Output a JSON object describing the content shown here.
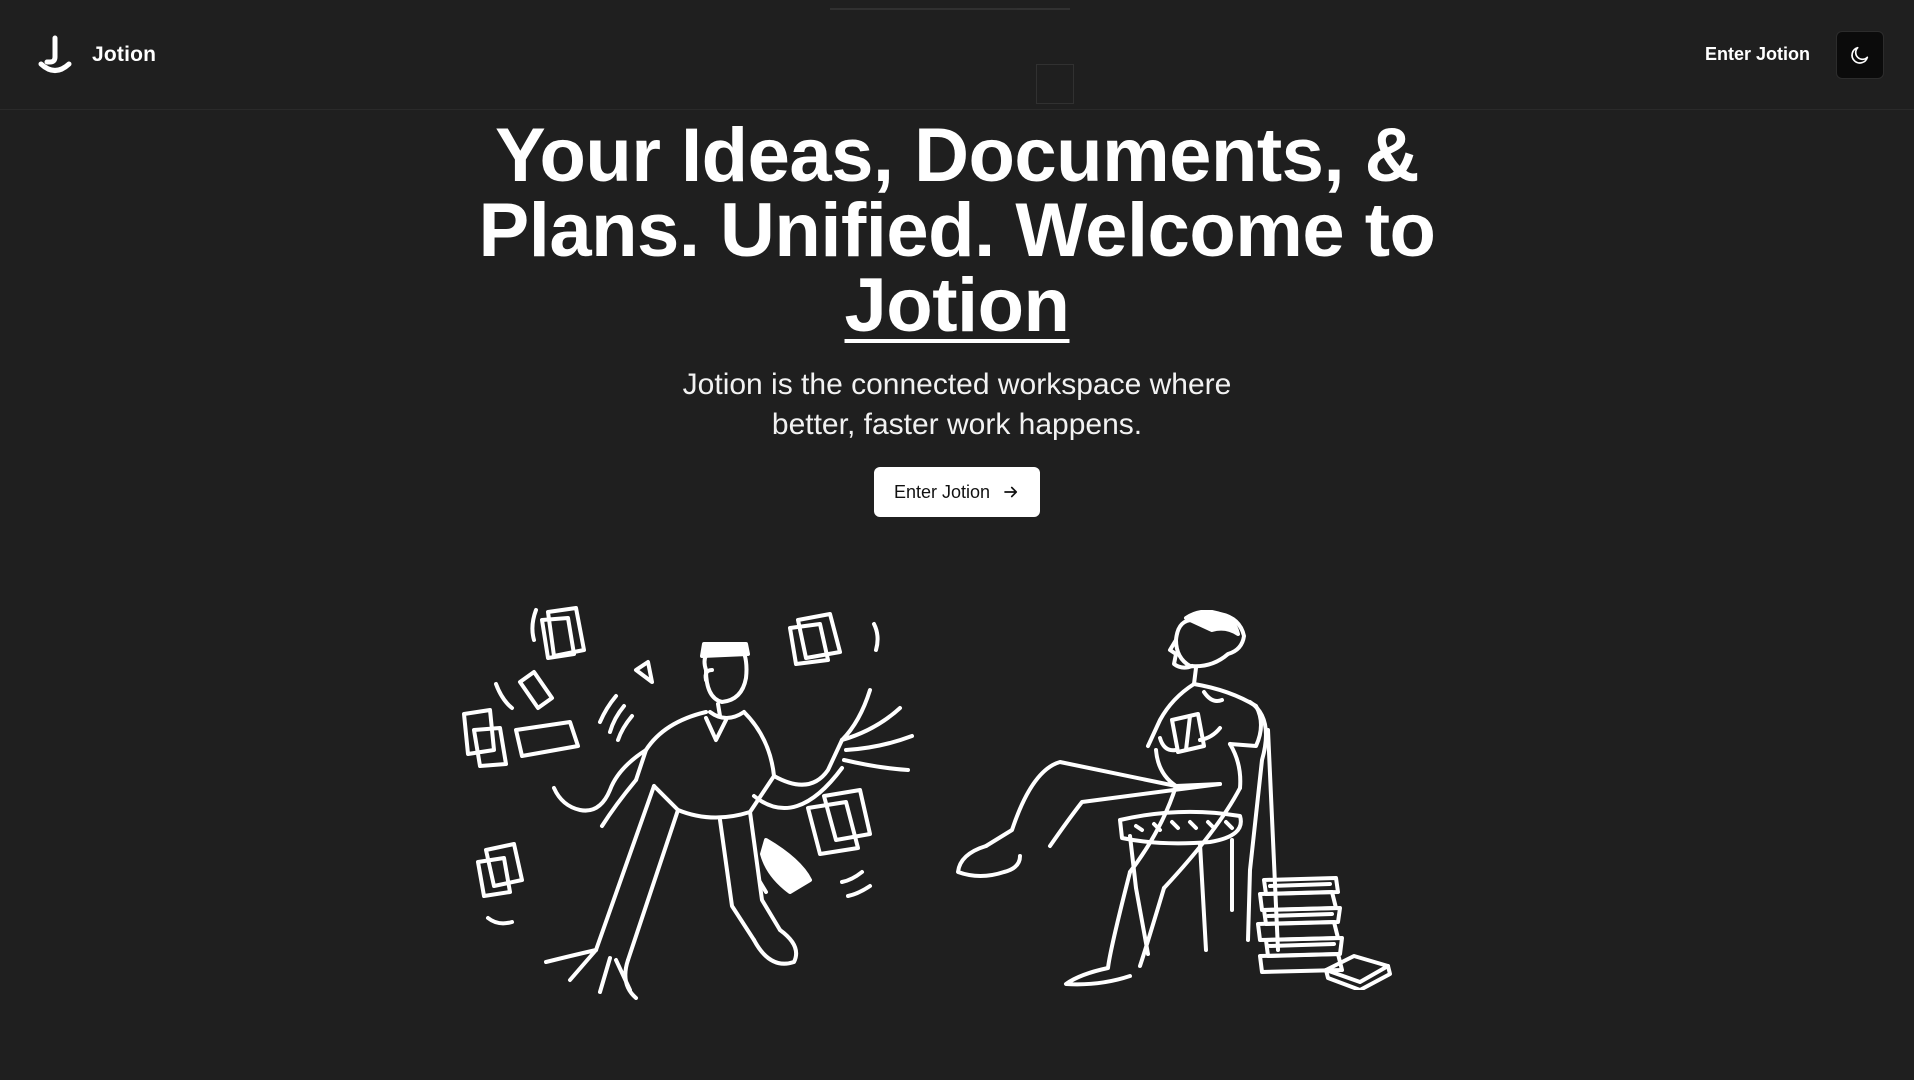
{
  "navbar": {
    "brand_name": "Jotion",
    "logo_icon": "jotion-logo-icon",
    "enter_link": "Enter Jotion",
    "theme_toggle_icon": "moon-icon"
  },
  "hero": {
    "title_line": "Your Ideas, Documents, & Plans. Unified. Welcome to",
    "title_brand": "Jotion",
    "subtitle": "Jotion is the connected workspace where better, faster work happens.",
    "cta_label": "Enter Jotion",
    "cta_icon": "arrow-right-icon"
  },
  "illustrations": {
    "left": "juggling-papers-illustration",
    "right": "reading-woman-illustration"
  },
  "colors": {
    "background": "#1f1f1f",
    "text": "#ffffff",
    "cta_background": "#ffffff",
    "cta_text": "#111111",
    "toggle_background": "#0b0b0b"
  }
}
